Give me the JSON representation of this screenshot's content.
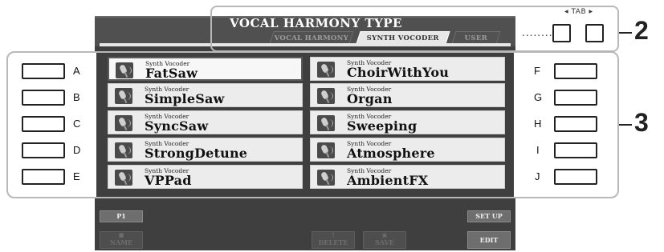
{
  "panel": {
    "title": "VOCAL HARMONY TYPE",
    "tabs": [
      {
        "label": "VOCAL HARMONY",
        "active": false
      },
      {
        "label": "SYNTH VOCODER",
        "active": true
      },
      {
        "label": "USER",
        "active": false
      }
    ]
  },
  "tab_control": {
    "label": "TAB",
    "left_arrow": "◀",
    "right_arrow": "▶",
    "dots": "........"
  },
  "callouts": {
    "tab": "2",
    "selection": "3"
  },
  "side_buttons": {
    "left": [
      "A",
      "B",
      "C",
      "D",
      "E"
    ],
    "right": [
      "F",
      "G",
      "H",
      "I",
      "J"
    ]
  },
  "voices": {
    "left": [
      {
        "category": "Synth Vocoder",
        "name": "FatSaw",
        "selected": true
      },
      {
        "category": "Synth Vocoder",
        "name": "SimpleSaw",
        "selected": false
      },
      {
        "category": "Synth Vocoder",
        "name": "SyncSaw",
        "selected": false
      },
      {
        "category": "Synth Vocoder",
        "name": "StrongDetune",
        "selected": false
      },
      {
        "category": "Synth Vocoder",
        "name": "VPPad",
        "selected": false
      }
    ],
    "right": [
      {
        "category": "Synth Vocoder",
        "name": "ChoirWithYou",
        "selected": false
      },
      {
        "category": "Synth Vocoder",
        "name": "Organ",
        "selected": false
      },
      {
        "category": "Synth Vocoder",
        "name": "Sweeping",
        "selected": false
      },
      {
        "category": "Synth Vocoder",
        "name": "Atmosphere",
        "selected": false
      },
      {
        "category": "Synth Vocoder",
        "name": "AmbientFX",
        "selected": false
      }
    ]
  },
  "bottom_bar": {
    "page": "P1",
    "setup": "SET UP",
    "name": "NAME",
    "delete": "DELETE",
    "save": "SAVE",
    "edit": "EDIT"
  },
  "colors": {
    "screen": "#3f3f3f",
    "button_face": "#ececec",
    "active_tab": "#e7e7e7",
    "callout_frame": "#b8b8b8"
  },
  "icons": {
    "voice": "microphone-icon",
    "tab_left": "triangle-left-icon",
    "tab_right": "triangle-right-icon"
  }
}
